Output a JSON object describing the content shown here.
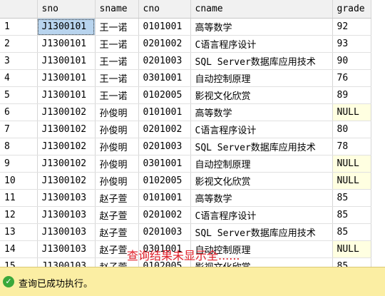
{
  "columns": [
    "sno",
    "sname",
    "cno",
    "cname",
    "grade"
  ],
  "rows": [
    {
      "n": "1",
      "sno": "J1300101",
      "sname": "王一诺",
      "cno": "0101001",
      "cname": "高等数学",
      "grade": "92"
    },
    {
      "n": "2",
      "sno": "J1300101",
      "sname": "王一诺",
      "cno": "0201002",
      "cname": "C语言程序设计",
      "grade": "93"
    },
    {
      "n": "3",
      "sno": "J1300101",
      "sname": "王一诺",
      "cno": "0201003",
      "cname": "SQL Server数据库应用技术",
      "grade": "90"
    },
    {
      "n": "4",
      "sno": "J1300101",
      "sname": "王一诺",
      "cno": "0301001",
      "cname": "自动控制原理",
      "grade": "76"
    },
    {
      "n": "5",
      "sno": "J1300101",
      "sname": "王一诺",
      "cno": "0102005",
      "cname": "影视文化欣赏",
      "grade": "89"
    },
    {
      "n": "6",
      "sno": "J1300102",
      "sname": "孙俊明",
      "cno": "0101001",
      "cname": "高等数学",
      "grade": "NULL"
    },
    {
      "n": "7",
      "sno": "J1300102",
      "sname": "孙俊明",
      "cno": "0201002",
      "cname": "C语言程序设计",
      "grade": "80"
    },
    {
      "n": "8",
      "sno": "J1300102",
      "sname": "孙俊明",
      "cno": "0201003",
      "cname": "SQL Server数据库应用技术",
      "grade": "78"
    },
    {
      "n": "9",
      "sno": "J1300102",
      "sname": "孙俊明",
      "cno": "0301001",
      "cname": "自动控制原理",
      "grade": "NULL"
    },
    {
      "n": "10",
      "sno": "J1300102",
      "sname": "孙俊明",
      "cno": "0102005",
      "cname": "影视文化欣赏",
      "grade": "NULL"
    },
    {
      "n": "11",
      "sno": "J1300103",
      "sname": "赵子萱",
      "cno": "0101001",
      "cname": "高等数学",
      "grade": "85"
    },
    {
      "n": "12",
      "sno": "J1300103",
      "sname": "赵子萱",
      "cno": "0201002",
      "cname": "C语言程序设计",
      "grade": "85"
    },
    {
      "n": "13",
      "sno": "J1300103",
      "sname": "赵子萱",
      "cno": "0201003",
      "cname": "SQL Server数据库应用技术",
      "grade": "85"
    },
    {
      "n": "14",
      "sno": "J1300103",
      "sname": "赵子萱",
      "cno": "0301001",
      "cname": "自动控制原理",
      "grade": "NULL"
    },
    {
      "n": "15",
      "sno": "J1300103",
      "sname": "赵子萱",
      "cno": "0102005",
      "cname": "影视文化欣赏",
      "grade": "85"
    }
  ],
  "overlay_note": "查询结果未显示全......",
  "status": {
    "icon": "success-check-icon",
    "text": "查询已成功执行。"
  },
  "colors": {
    "selected": "#b8d4ee",
    "null_cell": "#ffffe1",
    "status_bar": "#fbeea3",
    "note": "#e0202a"
  }
}
